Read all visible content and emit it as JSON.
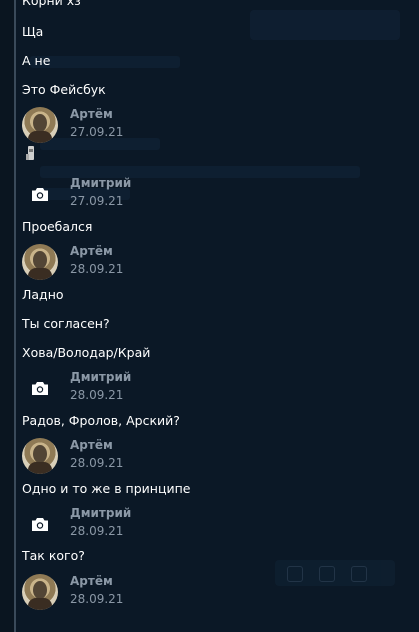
{
  "messages": [
    {
      "type": "text",
      "text": "Корни хз"
    },
    {
      "type": "text",
      "text": "Ща"
    },
    {
      "type": "text",
      "text": "А не"
    },
    {
      "type": "text",
      "text": "Это Фейсбук"
    },
    {
      "type": "author",
      "name": "Артём",
      "date": "27.09.21",
      "avatar": "photo"
    },
    {
      "type": "sticker",
      "icon": "sticker-icon"
    },
    {
      "type": "author",
      "name": "Дмитрий",
      "date": "27.09.21",
      "avatar": "camera-icon"
    },
    {
      "type": "text",
      "text": "Проебался"
    },
    {
      "type": "author",
      "name": "Артём",
      "date": "28.09.21",
      "avatar": "photo"
    },
    {
      "type": "text",
      "text": "Ладно"
    },
    {
      "type": "text",
      "text": "Ты согласен?"
    },
    {
      "type": "text",
      "text": "Хова/Володар/Край"
    },
    {
      "type": "author",
      "name": "Дмитрий",
      "date": "28.09.21",
      "avatar": "camera-icon"
    },
    {
      "type": "text",
      "text": "Радов, Фролов, Арский?"
    },
    {
      "type": "author",
      "name": "Артём",
      "date": "28.09.21",
      "avatar": "photo"
    },
    {
      "type": "text",
      "text": "Одно и то же в принципе"
    },
    {
      "type": "author",
      "name": "Дмитрий",
      "date": "28.09.21",
      "avatar": "camera-icon"
    },
    {
      "type": "text",
      "text": "Так кого?"
    },
    {
      "type": "author",
      "name": "Артём",
      "date": "28.09.21",
      "avatar": "photo"
    }
  ],
  "colors": {
    "background": "#0b1826",
    "message_text": "#ffffff",
    "meta_text": "#8b98a6"
  }
}
